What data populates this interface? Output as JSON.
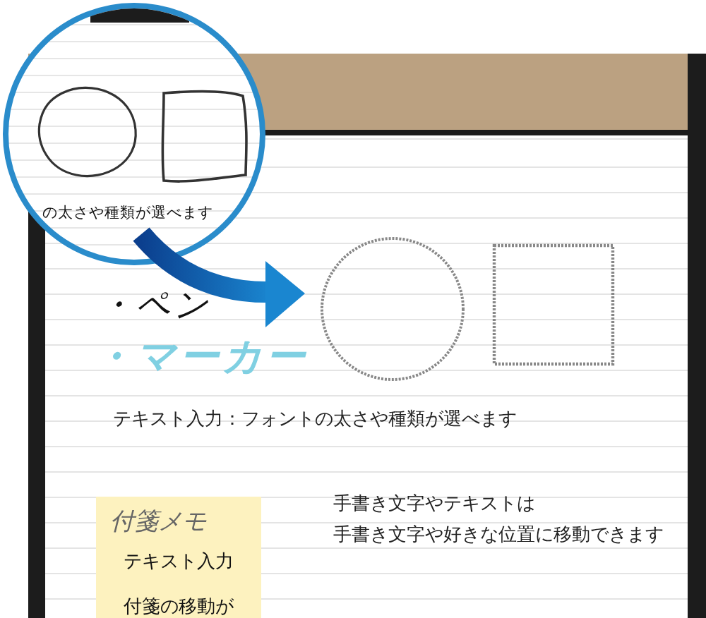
{
  "callout": {
    "caption": "の太さや種類が選べます"
  },
  "note": {
    "handwriting": [
      {
        "text": "・ペン",
        "kind": "pen"
      },
      {
        "text": "・マーカー",
        "kind": "marker"
      }
    ],
    "text_input": "テキスト入力：フォントの太さや種類が選べます",
    "move_text": [
      "手書き文字やテキストは",
      "手書き文字や好きな位置に移動できます"
    ],
    "sticky": {
      "handwriting": "付箋メモ",
      "text": "テキスト入力",
      "footer": "付箋の移動が"
    }
  }
}
